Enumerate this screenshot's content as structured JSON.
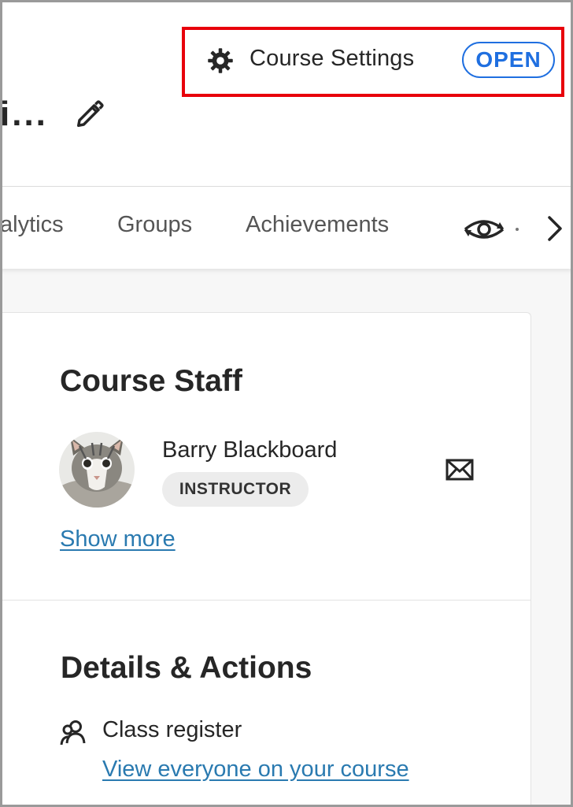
{
  "header": {
    "title_truncated": "i...",
    "settings_label": "Course Settings",
    "settings_status": "OPEN",
    "gear_icon": "gear-icon",
    "edit_icon": "pencil-icon"
  },
  "tabs": [
    {
      "label": "alytics"
    },
    {
      "label": "Groups"
    },
    {
      "label": "Achievements"
    }
  ],
  "tab_icons": {
    "preview": "eye-refresh-icon",
    "next": "chevron-right-icon"
  },
  "staff": {
    "heading": "Course Staff",
    "members": [
      {
        "name": "Barry Blackboard",
        "role": "INSTRUCTOR"
      }
    ],
    "show_more": "Show more"
  },
  "details": {
    "heading": "Details & Actions",
    "register_label": "Class register",
    "register_link": "View everyone on your course"
  },
  "colors": {
    "highlight": "#e8000b",
    "accent_blue": "#1f6fe0",
    "link": "#2a7ab0",
    "text": "#262626"
  }
}
